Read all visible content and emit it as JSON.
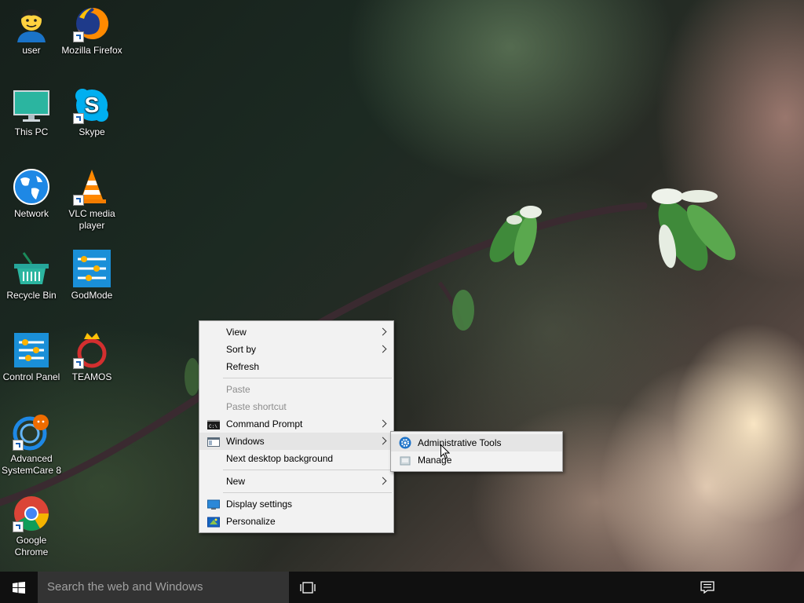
{
  "desktop": {
    "icons": [
      {
        "label": "user"
      },
      {
        "label": "Mozilla Firefox"
      },
      {
        "label": "This PC"
      },
      {
        "label": "Skype"
      },
      {
        "label": "Network"
      },
      {
        "label": "VLC media player"
      },
      {
        "label": "Recycle Bin"
      },
      {
        "label": "GodMode"
      },
      {
        "label": "Control Panel"
      },
      {
        "label": "TEAMOS"
      },
      {
        "label": "Advanced SystemCare 8"
      },
      {
        "label": "Google Chrome"
      }
    ]
  },
  "context_menu": {
    "items": [
      {
        "label": "View"
      },
      {
        "label": "Sort by"
      },
      {
        "label": "Refresh"
      },
      {
        "label": "Paste"
      },
      {
        "label": "Paste shortcut"
      },
      {
        "label": "Command Prompt"
      },
      {
        "label": "Windows"
      },
      {
        "label": "Next desktop background"
      },
      {
        "label": "New"
      },
      {
        "label": "Display settings"
      },
      {
        "label": "Personalize"
      }
    ]
  },
  "submenu": {
    "items": [
      {
        "label": "Administrative Tools"
      },
      {
        "label": "Manage"
      }
    ]
  },
  "taskbar": {
    "search_placeholder": "Search the web and Windows"
  },
  "colors": {
    "accent": "#1a73c8",
    "menu_bg": "#f2f2f2",
    "taskbar_bg": "#101010",
    "search_bg": "#333333"
  }
}
